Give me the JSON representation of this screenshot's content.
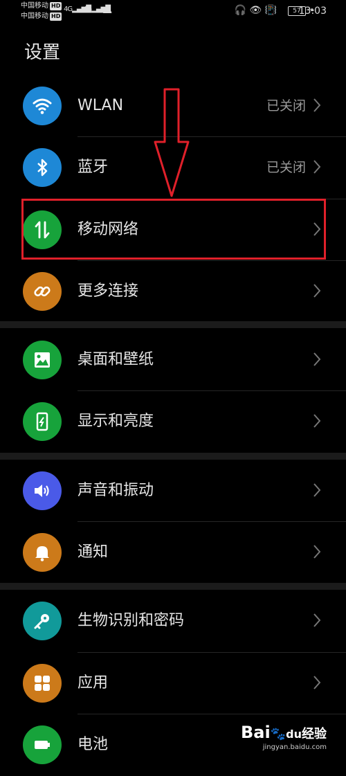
{
  "status_bar": {
    "carrier1": "中国移动",
    "carrier2": "中国移动",
    "hd": "HD",
    "network1": "4G",
    "network2": "4G",
    "battery": "57",
    "time": "13:03"
  },
  "title": "设置",
  "items": [
    {
      "label": "WLAN",
      "value": "已关闭",
      "icon": "wifi-icon",
      "color": "#1e88d6"
    },
    {
      "label": "蓝牙",
      "value": "已关闭",
      "icon": "bluetooth-icon",
      "color": "#1e88d6"
    },
    {
      "label": "移动网络",
      "value": "",
      "icon": "mobile-network-icon",
      "color": "#17a33b"
    },
    {
      "label": "更多连接",
      "value": "",
      "icon": "link-icon",
      "color": "#cc7a1a"
    },
    {
      "label": "桌面和壁纸",
      "value": "",
      "icon": "image-icon",
      "color": "#17a33b"
    },
    {
      "label": "显示和亮度",
      "value": "",
      "icon": "display-icon",
      "color": "#17a33b"
    },
    {
      "label": "声音和振动",
      "value": "",
      "icon": "speaker-icon",
      "color": "#4a5ae8"
    },
    {
      "label": "通知",
      "value": "",
      "icon": "bell-icon",
      "color": "#cc7a1a"
    },
    {
      "label": "生物识别和密码",
      "value": "",
      "icon": "key-icon",
      "color": "#119a9a"
    },
    {
      "label": "应用",
      "value": "",
      "icon": "apps-icon",
      "color": "#cc7a1a"
    },
    {
      "label": "电池",
      "value": "",
      "icon": "battery-icon",
      "color": "#17a33b"
    }
  ],
  "watermark": {
    "logo": "Bai",
    "logo_mid": "du",
    "logo_tail": "经验",
    "sub": "jingyan.baidu.com"
  },
  "highlight_color": "#e0202a"
}
